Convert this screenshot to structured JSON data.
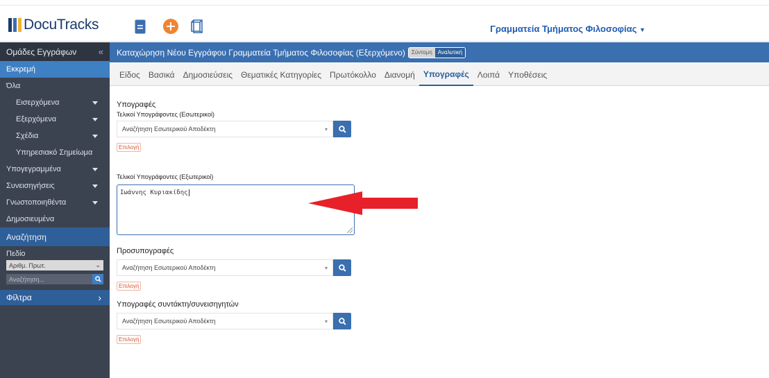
{
  "app": {
    "logo_text": "DocuTracks",
    "department": "Γραμματεία Τμήματος Φιλοσοφίας",
    "icons": [
      "document-icon",
      "add-icon",
      "box-icon"
    ],
    "colors": {
      "brand": "#3a6fb0",
      "accent": "#f28430",
      "arrow": "#e8202a",
      "sidebar": "#3b4250"
    }
  },
  "sidebar": {
    "header": "Ομάδες Εγγράφων",
    "collapse_label": "«",
    "items": [
      {
        "label": "Εκκρεμή"
      },
      {
        "label": "Όλα"
      },
      {
        "label": "Εισερχόμενα"
      },
      {
        "label": "Εξερχόμενα"
      },
      {
        "label": "Σχέδια"
      },
      {
        "label": "Υπηρεσιακό Σημείωμα"
      },
      {
        "label": "Υπογεγραμμένα"
      },
      {
        "label": "Συνεισηγήσεις"
      },
      {
        "label": "Γνωστοποιηθέντα"
      },
      {
        "label": "Δημοσιευμένα"
      }
    ],
    "search_header": "Αναζήτηση",
    "field_label": "Πεδίο",
    "field_value": "Αριθμ. Πρωτ.",
    "search_placeholder": "Αναζήτηση...",
    "filters_label": "Φίλτρα",
    "filters_arrow": "›"
  },
  "main": {
    "title": "Καταχώρηση Νέου Εγγράφου Γραμματεία Τμήματος Φιλοσοφίας (Εξερχόμενο)",
    "view_short": "Σύντομη",
    "view_detailed": "Αναλυτική",
    "tabs": [
      {
        "label": "Είδος"
      },
      {
        "label": "Βασικά"
      },
      {
        "label": "Δημοσιεύσεις"
      },
      {
        "label": "Θεματικές Κατηγορίες"
      },
      {
        "label": "Πρωτόκολλο"
      },
      {
        "label": "Διανομή"
      },
      {
        "label": "Υπογραφές"
      },
      {
        "label": "Λοιπά"
      },
      {
        "label": "Υποθέσεις"
      }
    ],
    "active_tab": "Υπογραφές"
  },
  "form": {
    "signatures_title": "Υπογραφές",
    "internal_label": "Τελικοί Υπογράφοντες (Εσωτερικοί)",
    "internal_placeholder": "Αναζήτηση Εσωτερικού Αποδέκτη",
    "choose_label": "Επιλογή",
    "external_label": "Τελικοί Υπογράφοντες (Εξωτερικοί)",
    "external_value": "Ιωάννης Κυριακίδης",
    "presign_title": "Προσυπογραφές",
    "presign_placeholder": "Αναζήτηση Εσωτερικού Αποδέκτη",
    "authors_title": "Υπογραφές συντάκτη/συνεισηγητών",
    "authors_placeholder": "Αναζήτηση Εσωτερικού Αποδέκτη"
  }
}
